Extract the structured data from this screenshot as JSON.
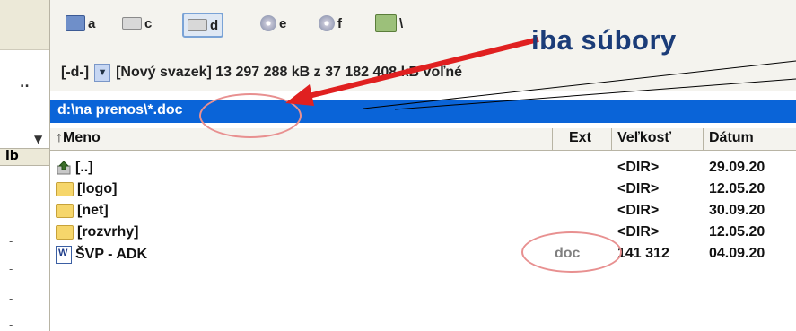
{
  "left_panel": {
    "dots": "..",
    "column_label": "ib",
    "dashes": [
      "-",
      "-",
      "-",
      "-"
    ]
  },
  "drives": [
    {
      "letter": "a",
      "icon": "floppy-drive-icon"
    },
    {
      "letter": "c",
      "icon": "hard-drive-icon"
    },
    {
      "letter": "d",
      "icon": "hard-drive-icon",
      "active": true
    },
    {
      "letter": "e",
      "icon": "cd-drive-icon"
    },
    {
      "letter": "f",
      "icon": "cd-drive-icon"
    },
    {
      "letter": "\\",
      "icon": "network-icon"
    }
  ],
  "drive_info": {
    "combo_value": "[-d-]",
    "text": "[Nový svazek]  13 297 288 kB z 37 182 408 kB voľné"
  },
  "current_path": "d:\\na prenos\\*.doc",
  "columns": {
    "name": "↑Meno",
    "ext": "Ext",
    "size": "Veľkosť",
    "date": "Dátum"
  },
  "rows": [
    {
      "name": "[..]",
      "ext": "",
      "size": "<DIR>",
      "date": "29.09.20",
      "icon": "up-folder-icon"
    },
    {
      "name": "[logo]",
      "ext": "",
      "size": "<DIR>",
      "date": "12.05.20",
      "icon": "folder-icon"
    },
    {
      "name": "[net]",
      "ext": "",
      "size": "<DIR>",
      "date": "30.09.20",
      "icon": "folder-icon"
    },
    {
      "name": "[rozvrhy]",
      "ext": "",
      "size": "<DIR>",
      "date": "12.05.20",
      "icon": "folder-icon"
    },
    {
      "name": "ŠVP - ADK",
      "ext": "doc",
      "size": "141 312",
      "date": "04.09.20",
      "icon": "word-doc-icon"
    }
  ],
  "annotation": {
    "text": "iba súbory",
    "arrow_color": "#e02020",
    "text_color": "#1b3c78"
  },
  "colors": {
    "selection_bar": "#0a64d8",
    "panel_bg": "#f4f3ee"
  }
}
